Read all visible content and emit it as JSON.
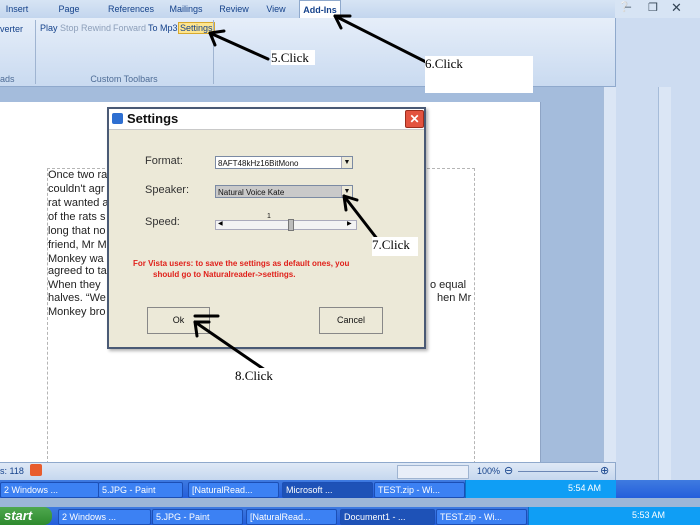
{
  "ribbon": {
    "tabs": [
      "Insert",
      "Page Layout",
      "References",
      "Mailings",
      "Review",
      "View",
      "Add-Ins"
    ],
    "left_clip_label": "verter",
    "toolbar_buttons": [
      "Play",
      "Stop",
      "Rewind",
      "Forward",
      "To Mp3",
      "Settings"
    ],
    "group_left_label": "ads",
    "group_label": "Custom Toolbars"
  },
  "document": {
    "lines": [
      "Once two ra",
      "couldn't agr",
      "rat wanted a",
      "of the rats s",
      "long that no",
      "friend, Mr M",
      "Monkey wa",
      "agreed to ta",
      "When they",
      "halves. “We",
      "Monkey bro"
    ],
    "right_fragments": [
      "o equal",
      "hen Mr"
    ]
  },
  "status_bar": {
    "page_info": "s: 118",
    "zoom": "100%"
  },
  "dialog": {
    "title": "Settings",
    "format_label": "Format:",
    "format_value": "8AFT48kHz16BitMono",
    "speaker_label": "Speaker:",
    "speaker_value": "Natural Voice Kate",
    "speed_label": "Speed:",
    "speed_value": "1",
    "vista_note_line1": "For Vista users: to save the settings as default ones, you",
    "vista_note_line2": "should go to Naturalreader->settings.",
    "ok_label": "Ok",
    "cancel_label": "Cancel"
  },
  "annotations": {
    "step5": "5.Click",
    "step6": "6.Click",
    "step7": "7.Click",
    "step8": "8.Click"
  },
  "taskbar_upper": {
    "items": [
      "2 Windows ...",
      "5.JPG - Paint",
      "[NaturalRead...",
      "Microsoft ...",
      "TEST.zip - Wi..."
    ],
    "clock": "5:54 AM"
  },
  "taskbar_lower": {
    "start": "start",
    "items": [
      "2 Windows ...",
      "5.JPG - Paint",
      "[NaturalRead...",
      "Document1 - ...",
      "TEST.zip - Wi..."
    ],
    "clock": "5:53 AM"
  }
}
